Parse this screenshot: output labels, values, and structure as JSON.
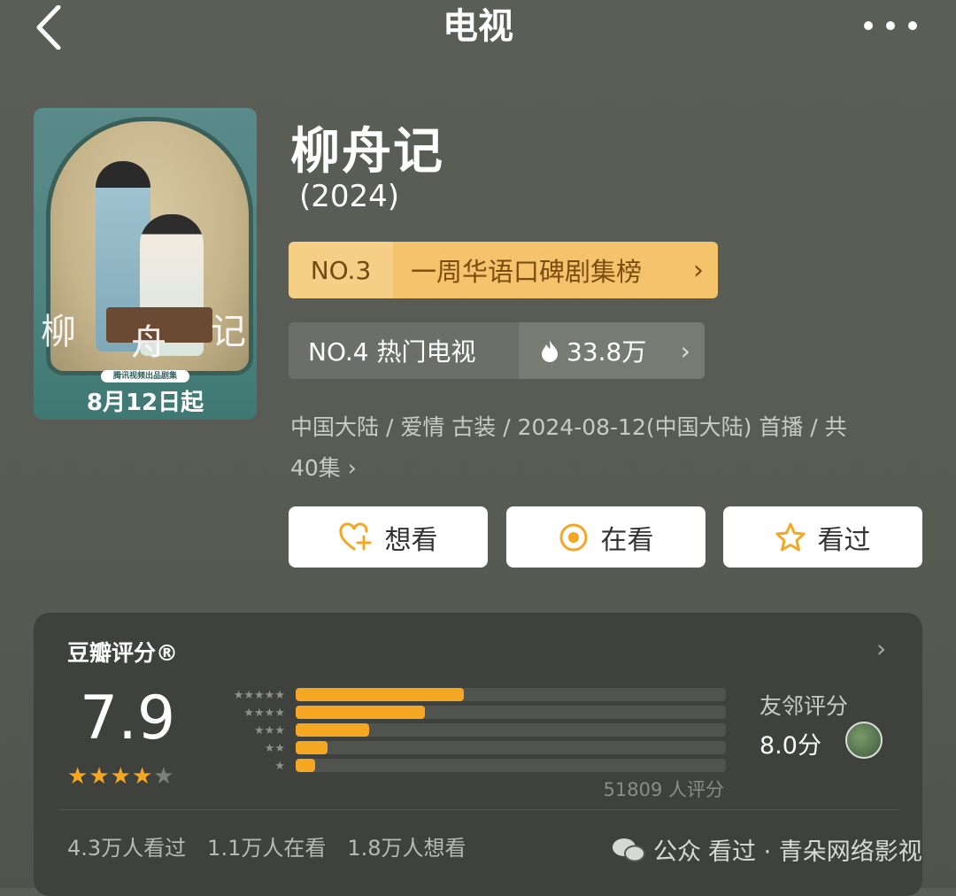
{
  "header": {
    "title": "电视"
  },
  "poster": {
    "calligraphy": [
      "柳",
      "舟",
      "记"
    ],
    "pill_text": "腾讯视频出品剧集",
    "date": "8月12日起"
  },
  "show": {
    "title": "柳舟记",
    "year": "(2024)"
  },
  "rank_weekly": {
    "no": "NO.3",
    "label": "一周华语口碑剧集榜",
    "chevron": "›"
  },
  "rank_hot": {
    "label": "NO.4 热门电视",
    "heat": "33.8万",
    "chevron": "›"
  },
  "meta": {
    "line1": "中国大陆 / 爱情 古装 / 2024-08-12(中国大陆) 首播 / 共",
    "line2": "40集",
    "chevron": "›"
  },
  "actions": [
    {
      "label": "想看",
      "icon": "heart-plus-icon"
    },
    {
      "label": "在看",
      "icon": "target-icon"
    },
    {
      "label": "看过",
      "icon": "star-outline-icon"
    }
  ],
  "rating": {
    "title": "豆瓣评分®",
    "score": "7.9",
    "stars": 4,
    "star_labels": [
      "★★★★★",
      "★★★★",
      "★★★",
      "★★",
      "★"
    ],
    "distribution": [
      0.39,
      0.3,
      0.17,
      0.075,
      0.045
    ],
    "count_text": "51809 人评分",
    "friend_label": "友邻评分",
    "friend_score": "8.0分",
    "stats": [
      "4.3万人看过",
      "1.1万人在看",
      "1.8万人想看"
    ]
  },
  "watermark": {
    "prefix": "公众",
    "text": "看过 · 青朵网络影视"
  },
  "colors": {
    "accent": "#f5a623",
    "rank_gold": "#f4c36c",
    "card_bg": "#3f413d"
  }
}
